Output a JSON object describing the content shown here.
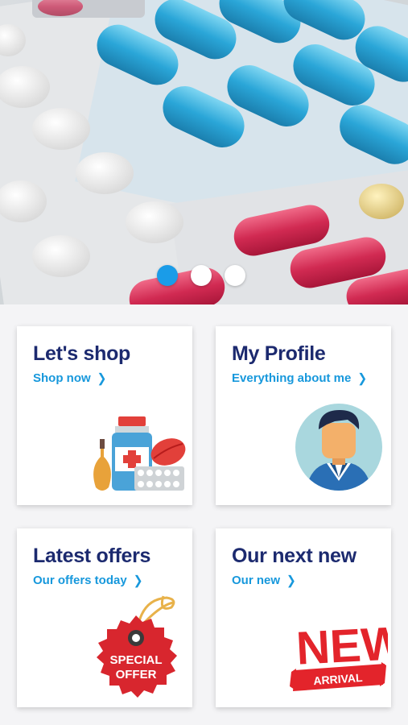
{
  "carousel": {
    "slide_count": 3,
    "active_index": 0
  },
  "cards": [
    {
      "title": "Let's shop",
      "link": "Shop now",
      "icon": "medicine-icon"
    },
    {
      "title": "My Profile",
      "link": "Everything about me",
      "icon": "user-avatar-icon"
    },
    {
      "title": "Latest offers",
      "link": "Our offers today",
      "icon": "special-offer-tag-icon"
    },
    {
      "title": "Our next new",
      "link": "Our new",
      "icon": "new-arrival-icon"
    }
  ],
  "badges": {
    "special_offer_line1": "SPECIAL",
    "special_offer_line2": "OFFER",
    "new_text": "NEW",
    "arrival_text": "ARRIVAL"
  },
  "colors": {
    "accent": "#1798dc",
    "title": "#1c2a6f",
    "dot_active": "#1a9ce8"
  }
}
